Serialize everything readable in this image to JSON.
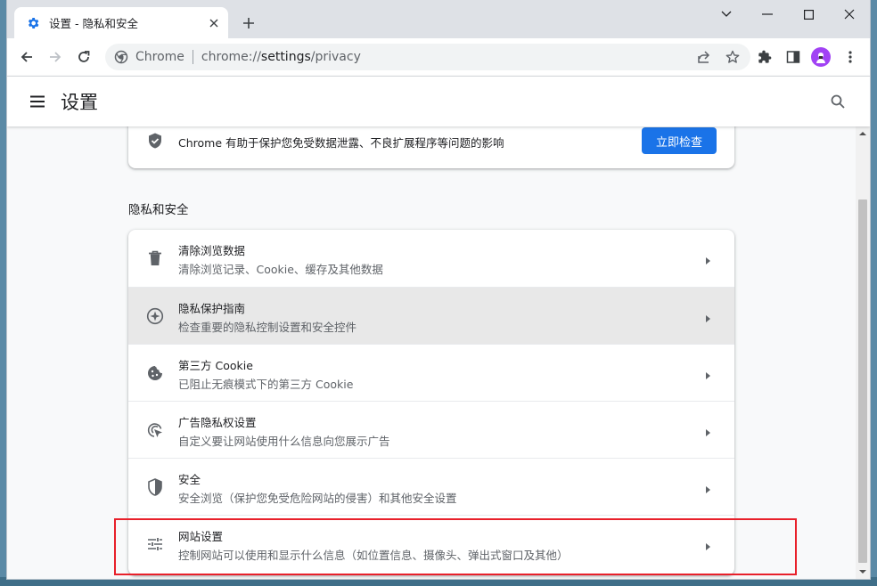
{
  "tab": {
    "title": "设置 - 隐私和安全"
  },
  "omnibox": {
    "site_label": "Chrome",
    "url_scheme": "chrome://",
    "url_host": "settings",
    "url_path": "/privacy"
  },
  "header": {
    "title": "设置"
  },
  "safety_check": {
    "text": "Chrome 有助于保护您免受数据泄露、不良扩展程序等问题的影响",
    "button_label": "立即检查"
  },
  "section": {
    "title": "隐私和安全"
  },
  "rows": [
    {
      "title": "清除浏览数据",
      "subtitle": "清除浏览记录、Cookie、缓存及其他数据",
      "icon": "trash-icon"
    },
    {
      "title": "隐私保护指南",
      "subtitle": "检查重要的隐私控制设置和安全控件",
      "icon": "compass-icon"
    },
    {
      "title": "第三方 Cookie",
      "subtitle": "已阻止无痕模式下的第三方 Cookie",
      "icon": "cookie-icon"
    },
    {
      "title": "广告隐私权设置",
      "subtitle": "自定义要让网站使用什么信息向您展示广告",
      "icon": "ad-privacy-icon"
    },
    {
      "title": "安全",
      "subtitle": "安全浏览（保护您免受危险网站的侵害）和其他安全设置",
      "icon": "shield-icon"
    },
    {
      "title": "网站设置",
      "subtitle": "控制网站可以使用和显示什么信息（如位置信息、摄像头、弹出式窗口及其他）",
      "icon": "tune-icon"
    }
  ],
  "colors": {
    "accent": "#1a73e8",
    "highlight": "#e8202a",
    "hover_row": "#e8e8e8",
    "avatar": "#a142f4"
  }
}
